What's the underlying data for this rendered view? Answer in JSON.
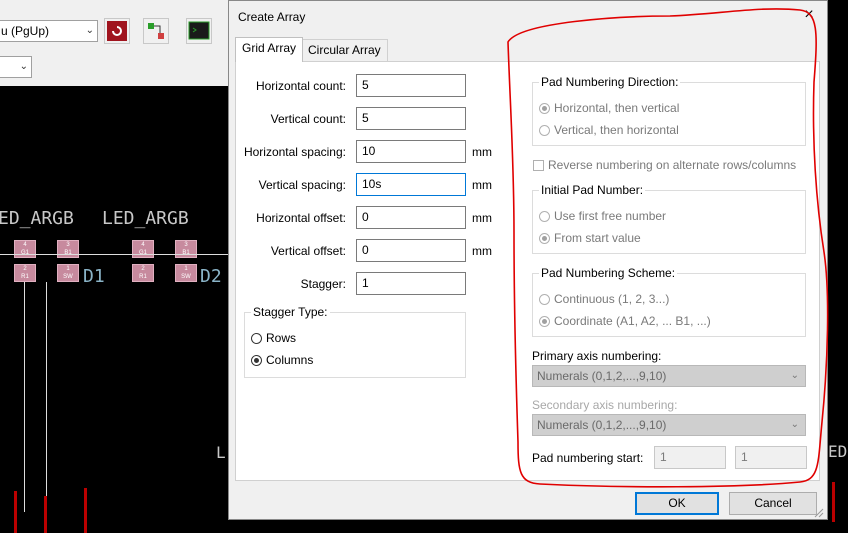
{
  "background": {
    "layer_select": "u (PgUp)",
    "pcb_labels": [
      "ED_ARGB",
      "LED_ARGB"
    ],
    "ref_labels": [
      "D1",
      "D2"
    ],
    "pad_labels": [
      {
        "num": "4",
        "name": "G1"
      },
      {
        "num": "3",
        "name": "B1"
      },
      {
        "num": "2",
        "name": "R1"
      },
      {
        "num": "1",
        "name": "SW"
      }
    ],
    "right_edge_label": "ED"
  },
  "dialog": {
    "title": "Create Array",
    "close_label": "×",
    "tabs": [
      {
        "label": "Grid Array",
        "active": true
      },
      {
        "label": "Circular Array",
        "active": false
      }
    ],
    "grid": {
      "horizontal_count": {
        "label": "Horizontal count:",
        "value": "5"
      },
      "vertical_count": {
        "label": "Vertical count:",
        "value": "5"
      },
      "horizontal_spacing": {
        "label": "Horizontal spacing:",
        "value": "10",
        "unit": "mm"
      },
      "vertical_spacing": {
        "label": "Vertical spacing:",
        "value": "10s",
        "unit": "mm"
      },
      "horizontal_offset": {
        "label": "Horizontal offset:",
        "value": "0",
        "unit": "mm"
      },
      "vertical_offset": {
        "label": "Vertical offset:",
        "value": "0",
        "unit": "mm"
      },
      "stagger": {
        "label": "Stagger:",
        "value": "1"
      },
      "stagger_type": {
        "title": "Stagger Type:",
        "options": [
          {
            "label": "Rows",
            "selected": false
          },
          {
            "label": "Columns",
            "selected": true
          }
        ]
      }
    },
    "numbering": {
      "direction": {
        "title": "Pad Numbering Direction:",
        "options": [
          {
            "label": "Horizontal, then vertical",
            "selected": true
          },
          {
            "label": "Vertical, then horizontal",
            "selected": false
          }
        ]
      },
      "reverse_label": "Reverse numbering on alternate rows/columns",
      "initial": {
        "title": "Initial Pad Number:",
        "options": [
          {
            "label": "Use first free number",
            "selected": false
          },
          {
            "label": "From start value",
            "selected": true
          }
        ]
      },
      "scheme": {
        "title": "Pad Numbering Scheme:",
        "options": [
          {
            "label": "Continuous (1, 2, 3...)",
            "selected": false
          },
          {
            "label": "Coordinate (A1, A2, ... B1, ...)",
            "selected": true
          }
        ]
      },
      "primary_axis": {
        "label": "Primary axis numbering:",
        "value": "Numerals (0,1,2,...,9,10)"
      },
      "secondary_axis": {
        "label": "Secondary axis numbering:",
        "value": "Numerals (0,1,2,...,9,10)"
      },
      "start": {
        "label": "Pad numbering start:",
        "primary": "1",
        "secondary": "1"
      }
    },
    "ok_label": "OK",
    "cancel_label": "Cancel"
  },
  "colors": {
    "annotation": "#e00000",
    "focus": "#0078d7",
    "pad": "#c78a9e"
  }
}
